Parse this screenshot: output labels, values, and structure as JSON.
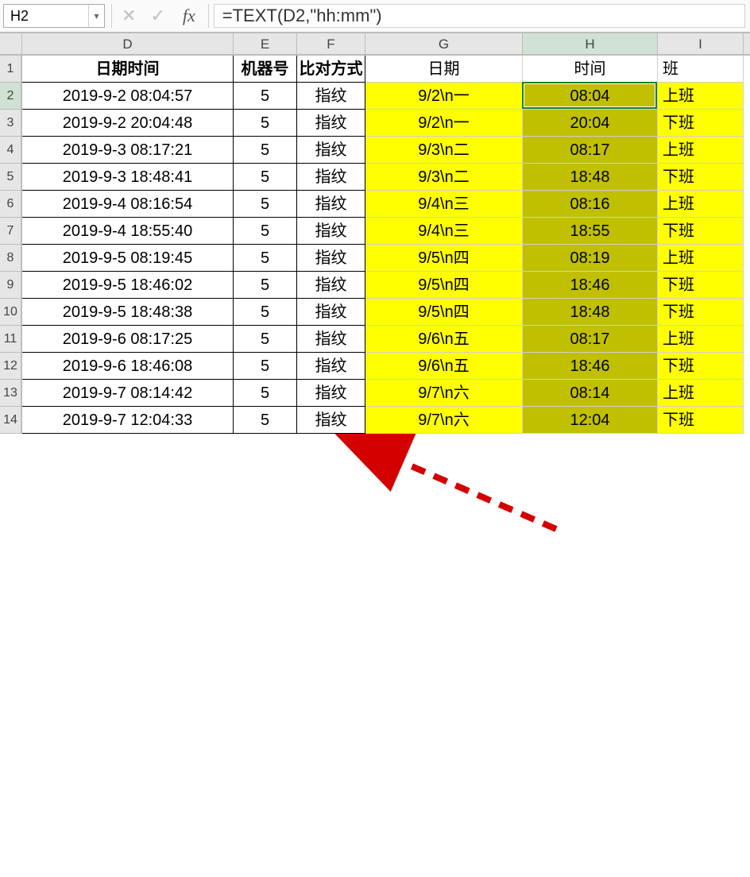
{
  "nameBox": "H2",
  "formula": "=TEXT(D2,\"hh:mm\")",
  "colHeaders": [
    "D",
    "E",
    "F",
    "G",
    "H",
    "I"
  ],
  "activeCol": 4,
  "header": {
    "D": "日期时间",
    "E": "机器号",
    "F": "比对方式",
    "G": "日期",
    "H": "时间",
    "I": "班"
  },
  "rows": [
    {
      "n": 2,
      "D": "2019-9-2 08:04:57",
      "E": "5",
      "F": "指纹",
      "G": "9/2\\n一",
      "H": "08:04",
      "I": "上班"
    },
    {
      "n": 3,
      "D": "2019-9-2 20:04:48",
      "E": "5",
      "F": "指纹",
      "G": "9/2\\n一",
      "H": "20:04",
      "I": "下班"
    },
    {
      "n": 4,
      "D": "2019-9-3 08:17:21",
      "E": "5",
      "F": "指纹",
      "G": "9/3\\n二",
      "H": "08:17",
      "I": "上班"
    },
    {
      "n": 5,
      "D": "2019-9-3 18:48:41",
      "E": "5",
      "F": "指纹",
      "G": "9/3\\n二",
      "H": "18:48",
      "I": "下班"
    },
    {
      "n": 6,
      "D": "2019-9-4 08:16:54",
      "E": "5",
      "F": "指纹",
      "G": "9/4\\n三",
      "H": "08:16",
      "I": "上班"
    },
    {
      "n": 7,
      "D": "2019-9-4 18:55:40",
      "E": "5",
      "F": "指纹",
      "G": "9/4\\n三",
      "H": "18:55",
      "I": "下班"
    },
    {
      "n": 8,
      "D": "2019-9-5 08:19:45",
      "E": "5",
      "F": "指纹",
      "G": "9/5\\n四",
      "H": "08:19",
      "I": "上班"
    },
    {
      "n": 9,
      "D": "2019-9-5 18:46:02",
      "E": "5",
      "F": "指纹",
      "G": "9/5\\n四",
      "H": "18:46",
      "I": "下班"
    },
    {
      "n": 10,
      "D": "2019-9-5 18:48:38",
      "E": "5",
      "F": "指纹",
      "G": "9/5\\n四",
      "H": "18:48",
      "I": "下班"
    },
    {
      "n": 11,
      "D": "2019-9-6 08:17:25",
      "E": "5",
      "F": "指纹",
      "G": "9/6\\n五",
      "H": "08:17",
      "I": "上班"
    },
    {
      "n": 12,
      "D": "2019-9-6 18:46:08",
      "E": "5",
      "F": "指纹",
      "G": "9/6\\n五",
      "H": "18:46",
      "I": "下班"
    },
    {
      "n": 13,
      "D": "2019-9-7 08:14:42",
      "E": "5",
      "F": "指纹",
      "G": "9/7\\n六",
      "H": "08:14",
      "I": "上班"
    },
    {
      "n": 14,
      "D": "2019-9-7 12:04:33",
      "E": "5",
      "F": "指纹",
      "G": "9/7\\n六",
      "H": "12:04",
      "I": "下班"
    }
  ],
  "activeRow": 2,
  "selectedCell": {
    "col": "H",
    "row": 2
  }
}
